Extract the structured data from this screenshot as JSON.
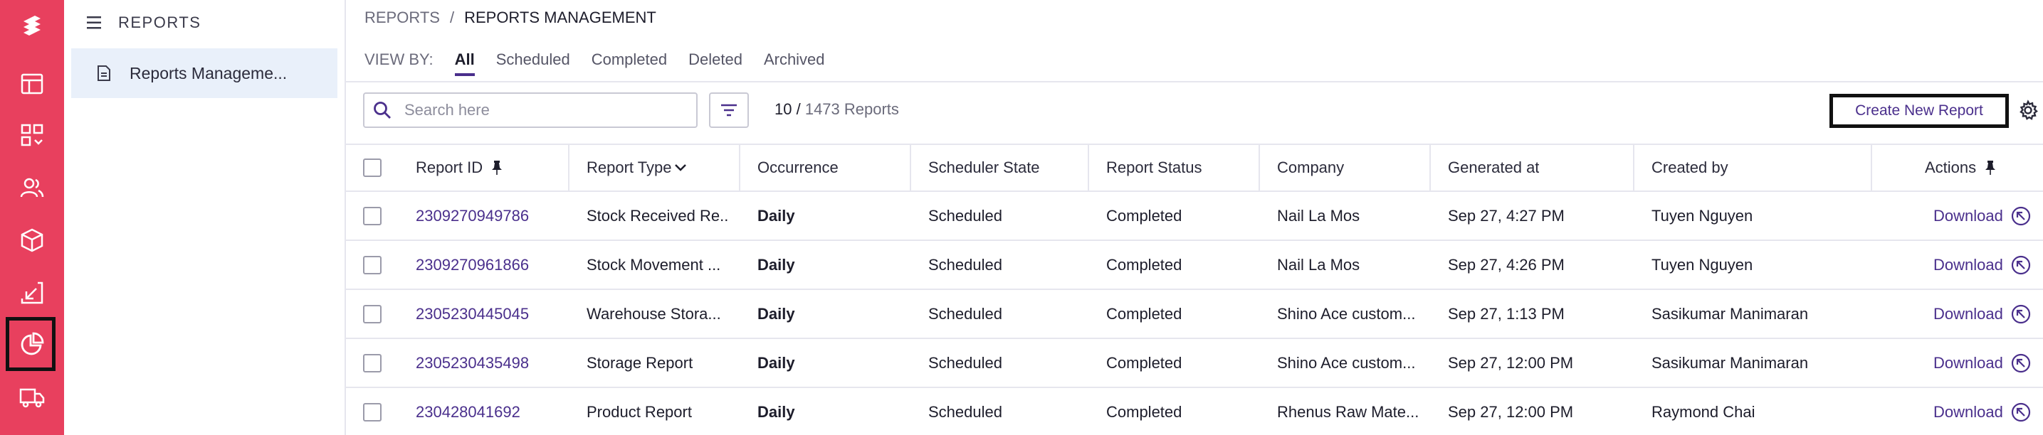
{
  "sidebar": {
    "section_title": "REPORTS",
    "items": [
      {
        "label": "Reports Manageme..."
      }
    ]
  },
  "rail": {
    "icons": [
      "logo-icon",
      "layout-icon",
      "dashboard-icon",
      "users-icon",
      "box-icon",
      "inbound-icon",
      "reports-pie-icon",
      "truck-icon"
    ],
    "active": "reports-pie-icon"
  },
  "breadcrumb": {
    "parent": "REPORTS",
    "separator": "/",
    "current": "REPORTS MANAGEMENT"
  },
  "view_by": {
    "label": "VIEW BY:",
    "tabs": [
      "All",
      "Scheduled",
      "Completed",
      "Deleted",
      "Archived"
    ],
    "active": "All"
  },
  "search": {
    "placeholder": "Search here"
  },
  "count": {
    "shown": "10 /",
    "total": "1473 Reports"
  },
  "toolbar": {
    "create_label": "Create New Report"
  },
  "colors": {
    "rail": "#e8405e",
    "accent": "#4a2f8c",
    "sidebar_active": "#e9f0fa"
  },
  "table": {
    "columns": [
      "Report ID",
      "Report Type",
      "Occurrence",
      "Scheduler State",
      "Report Status",
      "Company",
      "Generated at",
      "Created by",
      "Actions"
    ],
    "rows": [
      {
        "id": "2309270949786",
        "type": "Stock Received Re...",
        "occurrence": "Daily",
        "scheduler": "Scheduled",
        "status": "Completed",
        "company": "Nail La Mos",
        "generated": "Sep 27, 4:27 PM",
        "created_by": "Tuyen Nguyen",
        "action": "Download"
      },
      {
        "id": "2309270961866",
        "type": "Stock Movement ...",
        "occurrence": "Daily",
        "scheduler": "Scheduled",
        "status": "Completed",
        "company": "Nail La Mos",
        "generated": "Sep 27, 4:26 PM",
        "created_by": "Tuyen Nguyen",
        "action": "Download"
      },
      {
        "id": "2305230445045",
        "type": "Warehouse Stora...",
        "occurrence": "Daily",
        "scheduler": "Scheduled",
        "status": "Completed",
        "company": "Shino Ace custom...",
        "generated": "Sep 27, 1:13 PM",
        "created_by": "Sasikumar Manimaran",
        "action": "Download"
      },
      {
        "id": "2305230435498",
        "type": "Storage Report",
        "occurrence": "Daily",
        "scheduler": "Scheduled",
        "status": "Completed",
        "company": "Shino Ace custom...",
        "generated": "Sep 27, 12:00 PM",
        "created_by": "Sasikumar Manimaran",
        "action": "Download"
      },
      {
        "id": "230428041692",
        "type": "Product Report",
        "occurrence": "Daily",
        "scheduler": "Scheduled",
        "status": "Completed",
        "company": "Rhenus Raw Mate...",
        "generated": "Sep 27, 12:00 PM",
        "created_by": "Raymond Chai",
        "action": "Download"
      }
    ]
  }
}
